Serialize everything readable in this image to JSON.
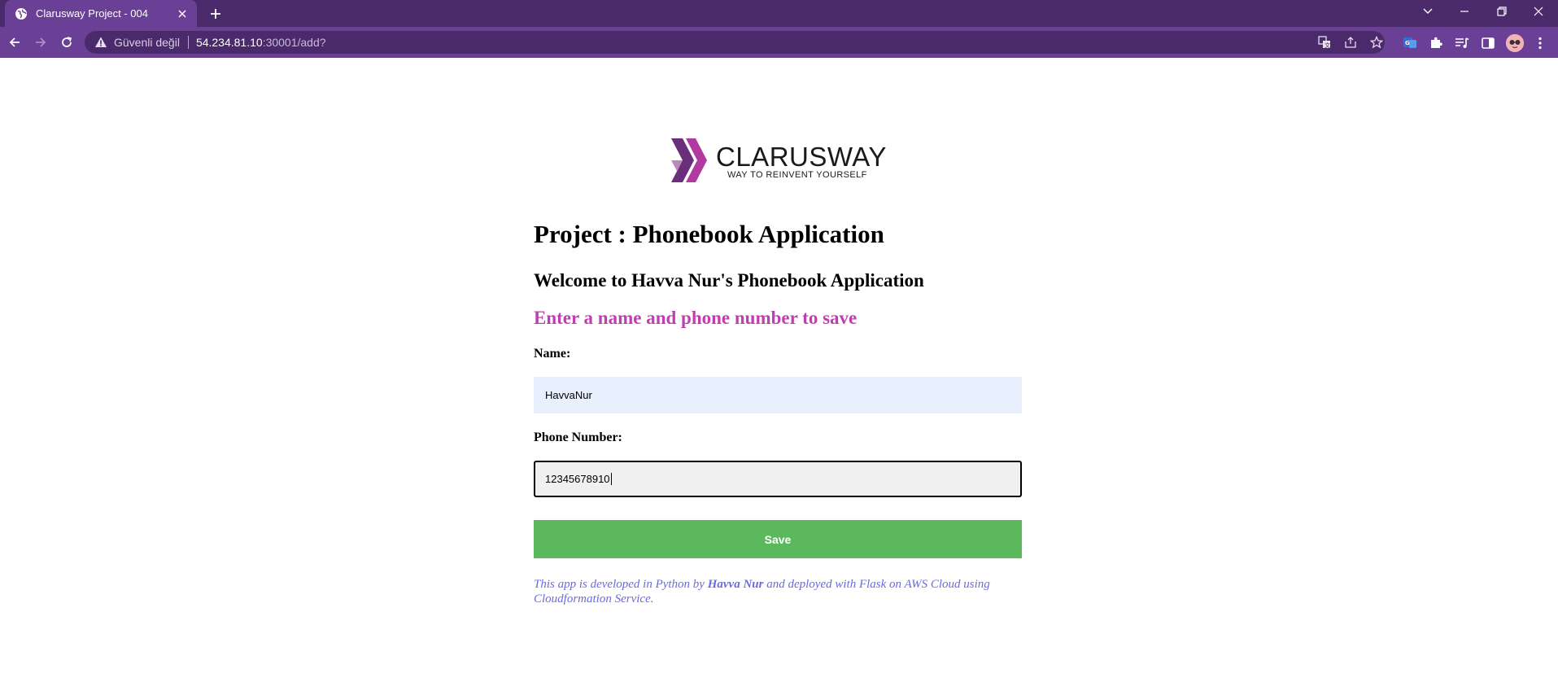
{
  "browser": {
    "tab_title": "Clarusway Project - 004",
    "security_label": "Güvenli değil",
    "url_host": "54.234.81.10",
    "url_path": ":30001/add?"
  },
  "page": {
    "logo_name": "CLARUSWAY",
    "logo_tagline": "WAY TO REINVENT YOURSELF",
    "heading": "Project : Phonebook Application",
    "welcome": "Welcome to Havva Nur's Phonebook Application",
    "instruction": "Enter a name and phone number to save",
    "name_label": "Name:",
    "name_value": "HavvaNur",
    "phone_label": "Phone Number:",
    "phone_value": "12345678910",
    "save_label": "Save",
    "footer_pre": "This app is developed in Python by ",
    "footer_author": "Havva Nur",
    "footer_post": " and deployed with Flask on AWS Cloud using Cloudformation Service."
  },
  "colors": {
    "tabstrip": "#4a2a6b",
    "toolbar": "#6a3f96",
    "instruction": "#c03fb0",
    "save_button": "#5cb85c",
    "footer_text": "#6a6ae0",
    "autofill_bg": "#e8f0fe"
  },
  "icons": {
    "tab": [
      "globe-icon",
      "close-icon",
      "plus-icon"
    ],
    "window": [
      "chevron-down-icon",
      "minimize-icon",
      "restore-icon",
      "close-window-icon"
    ],
    "nav": [
      "back-arrow-icon",
      "forward-arrow-icon",
      "reload-icon",
      "warning-icon"
    ],
    "omnibox": [
      "translate-icon",
      "share-icon",
      "star-icon"
    ],
    "toolbar": [
      "extension-badge-icon",
      "puzzle-icon",
      "media-queue-icon",
      "sidepanel-icon",
      "profile-avatar",
      "kebab-menu-icon"
    ]
  }
}
